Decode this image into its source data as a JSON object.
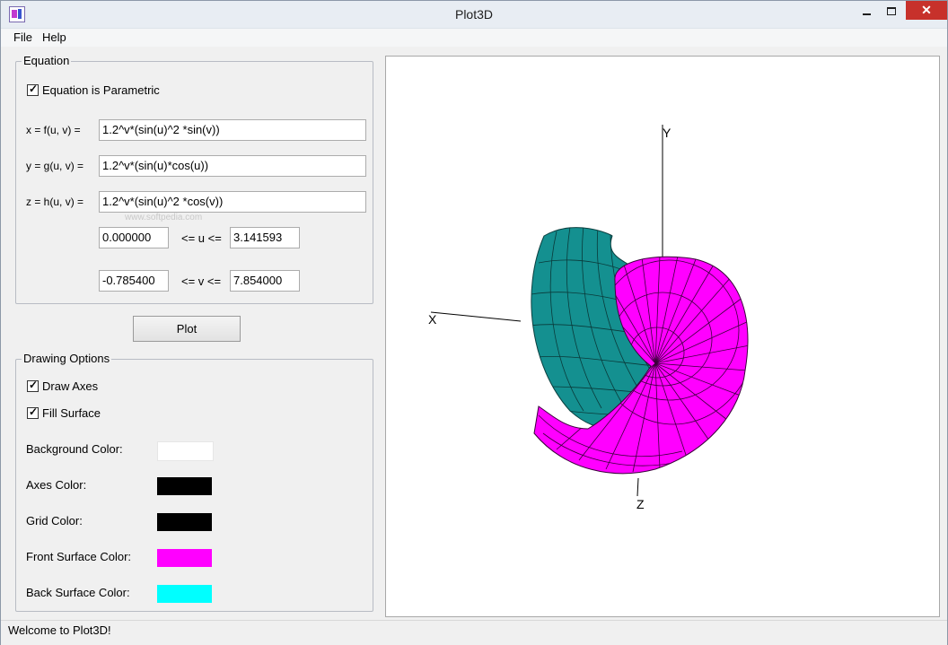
{
  "window": {
    "title": "Plot3D"
  },
  "menu": {
    "items": [
      "File",
      "Help"
    ]
  },
  "equation": {
    "group_label": "Equation",
    "parametric_label": "Equation is Parametric",
    "parametric_checked": true,
    "x_label": "x = f(u, v) =",
    "x_value": "1.2^v*(sin(u)^2 *sin(v))",
    "y_label": "y = g(u, v) =",
    "y_value": "1.2^v*(sin(u)*cos(u))",
    "z_label": "z = h(u, v) =",
    "z_value": "1.2^v*(sin(u)^2 *cos(v))",
    "u_min": "0.000000",
    "u_label": "<= u <=",
    "u_max": "3.141593",
    "v_min": "-0.785400",
    "v_label": "<= v <=",
    "v_max": "7.854000",
    "watermark": "www.softpedia.com"
  },
  "plot_button": {
    "label": "Plot"
  },
  "drawing_options": {
    "group_label": "Drawing Options",
    "draw_axes_label": "Draw Axes",
    "draw_axes_checked": true,
    "fill_surface_label": "Fill Surface",
    "fill_surface_checked": true,
    "background_color_label": "Background Color:",
    "background_color": "#ffffff",
    "axes_color_label": "Axes Color:",
    "axes_color": "#000000",
    "grid_color_label": "Grid Color:",
    "grid_color": "#000000",
    "front_surface_color_label": "Front Surface Color:",
    "front_surface_color": "#ff00ff",
    "back_surface_color_label": "Back Surface Color:",
    "back_surface_color": "#00ffff"
  },
  "plot": {
    "axis_x_label": "X",
    "axis_y_label": "Y",
    "axis_z_label": "Z",
    "back_surface_render_color": "#149090"
  },
  "status": {
    "text": "Welcome to Plot3D!"
  }
}
